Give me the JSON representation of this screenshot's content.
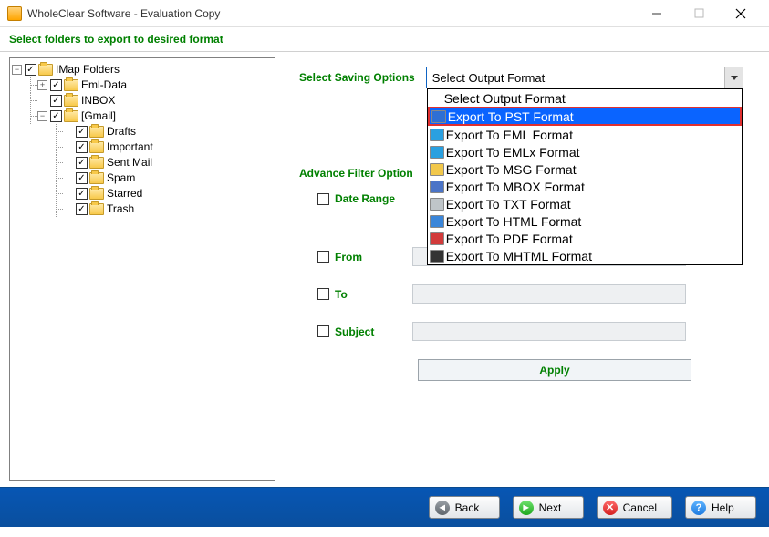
{
  "window": {
    "title": "WholeClear Software - Evaluation Copy"
  },
  "subheader": "Select folders to export to desired format",
  "tree": {
    "root": {
      "label": "IMap Folders"
    },
    "items": [
      {
        "label": "Eml-Data"
      },
      {
        "label": "INBOX"
      },
      {
        "label": "[Gmail]"
      }
    ],
    "gmail_children": [
      {
        "label": "Drafts"
      },
      {
        "label": "Important"
      },
      {
        "label": "Sent Mail"
      },
      {
        "label": "Spam"
      },
      {
        "label": "Starred"
      },
      {
        "label": "Trash"
      }
    ]
  },
  "options": {
    "saving_label": "Select Saving Options",
    "selected": "Select Output Format",
    "dropdown": [
      "Select Output Format",
      "Export To PST Format",
      "Export To EML Format",
      "Export To EMLx Format",
      "Export To MSG Format",
      "Export To MBOX Format",
      "Export To TXT Format",
      "Export To HTML Format",
      "Export To PDF Format",
      "Export To MHTML Format"
    ],
    "dropdown_selected_index": 1
  },
  "filter": {
    "heading": "Advance Filter Option",
    "date_range": "Date Range",
    "from": "From",
    "to": "To",
    "subject": "Subject",
    "apply": "Apply"
  },
  "buttons": {
    "back": "Back",
    "next": "Next",
    "cancel": "Cancel",
    "help": "Help"
  },
  "dd_icon_colors": [
    "#ffffff",
    "#2e6fd4",
    "#2aa0e0",
    "#2aa0e0",
    "#f2c84b",
    "#4b74c7",
    "#bfc5c9",
    "#3b86d9",
    "#d23b3b",
    "#333333"
  ]
}
